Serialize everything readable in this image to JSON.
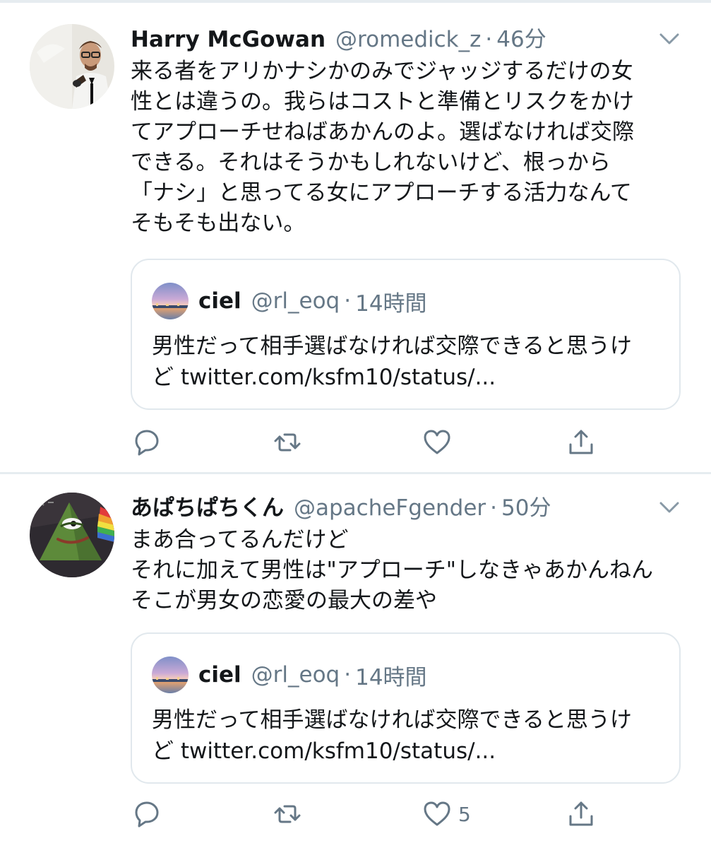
{
  "tweets": [
    {
      "display_name": "Harry McGowan",
      "handle": "@romedick_z",
      "separator": "·",
      "time": "46分",
      "avatar_icon": "avatar-photo-man-glasses",
      "body": "来る者をアリかナシかのみでジャッジするだけの女\n性とは違うの。我らはコストと準備とリスクをかけ\nてアプローチせねばあかんのよ。選ばなければ交際\nできる。それはそうかもしれないけど、根っから\n「ナシ」と思ってる女にアプローチする活力なんて\nそもそも出ない。",
      "quote": {
        "display_name": "ciel",
        "handle": "@rl_eoq",
        "separator": "·",
        "time": "14時間",
        "avatar_icon": "avatar-photo-sky",
        "text_line1": "男性だって相手選ばなければ交際できると思うけ",
        "text_prefix": "ど ",
        "link": "twitter.com/ksfm10/status/..."
      },
      "actions": {
        "like_count": ""
      }
    },
    {
      "display_name": "あぱちぱちくん",
      "handle": "@apacheFgender",
      "separator": "·",
      "time": "50分",
      "avatar_icon": "avatar-pepe-pyramid",
      "body": "まあ合ってるんだけど\nそれに加えて男性は\"アプローチ\"しなきゃあかんねん\nそこが男女の恋愛の最大の差や",
      "quote": {
        "display_name": "ciel",
        "handle": "@rl_eoq",
        "separator": "·",
        "time": "14時間",
        "avatar_icon": "avatar-photo-sky",
        "text_line1": "男性だって相手選ばなければ交際できると思うけ",
        "text_prefix": "ど ",
        "link": "twitter.com/ksfm10/status/..."
      },
      "actions": {
        "like_count": "5"
      }
    }
  ],
  "colors": {
    "text": "#14171a",
    "secondary": "#657786",
    "border": "#e1e8ed",
    "divider": "#e6ecf0"
  }
}
